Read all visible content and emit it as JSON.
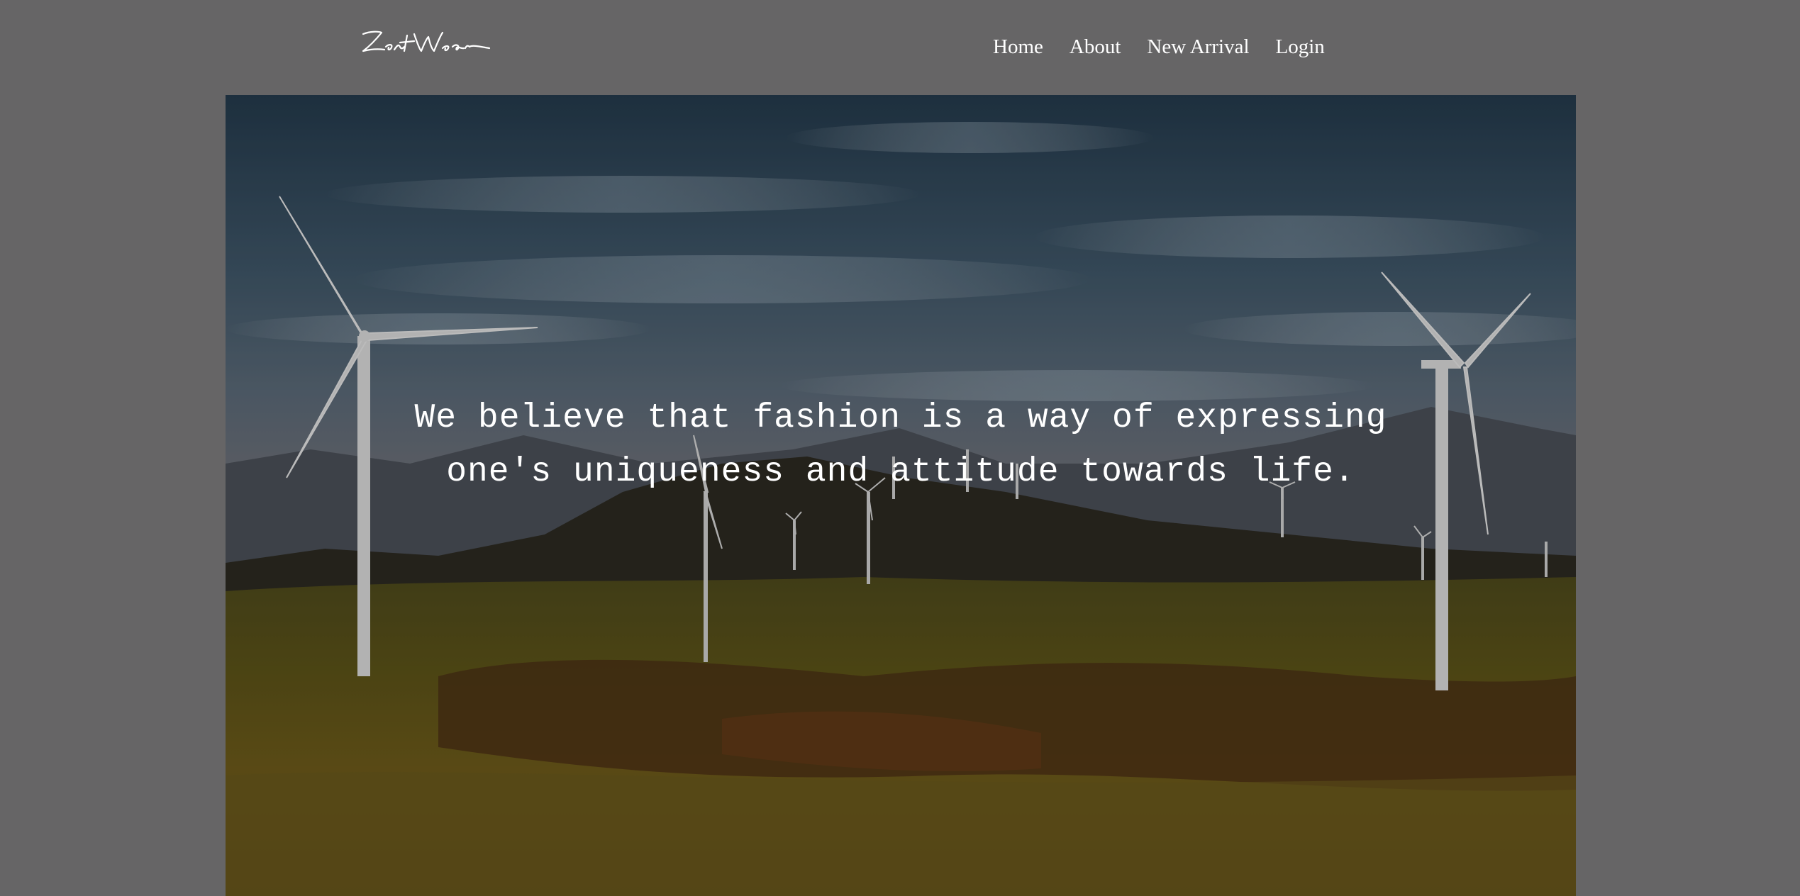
{
  "brand": {
    "logo_text": "ZestWear"
  },
  "nav": {
    "items": [
      {
        "label": "Home"
      },
      {
        "label": "About"
      },
      {
        "label": "New Arrival"
      },
      {
        "label": "Login"
      }
    ]
  },
  "hero": {
    "tagline": "We believe that fashion is a way of expressing\none's uniqueness and attitude towards life."
  },
  "colors": {
    "page_background": "#666566",
    "text": "#ffffff"
  }
}
